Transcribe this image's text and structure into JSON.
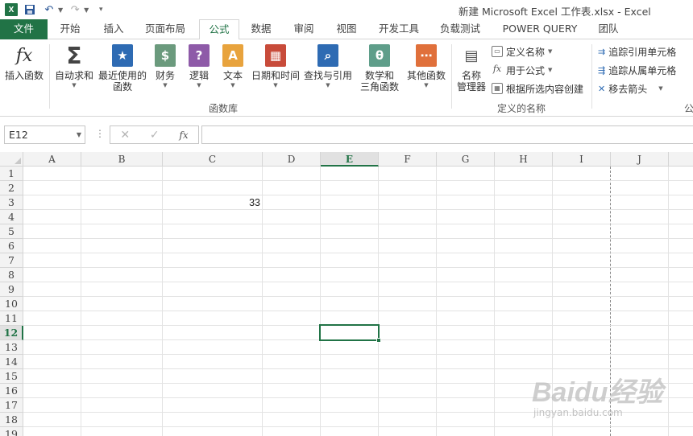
{
  "window": {
    "title": "新建 Microsoft Excel 工作表.xlsx - Excel"
  },
  "qat": {
    "logo": "X"
  },
  "tabs": [
    {
      "label": "文件"
    },
    {
      "label": "开始"
    },
    {
      "label": "插入"
    },
    {
      "label": "页面布局"
    },
    {
      "label": "公式"
    },
    {
      "label": "数据"
    },
    {
      "label": "审阅"
    },
    {
      "label": "视图"
    },
    {
      "label": "开发工具"
    },
    {
      "label": "负载测试"
    },
    {
      "label": "POWER QUERY"
    },
    {
      "label": "团队"
    }
  ],
  "ribbon": {
    "function_library": {
      "group_label": "函数库",
      "insert_function": {
        "icon": "fx",
        "label": "插入函数"
      },
      "autosum": {
        "label": "自动求和"
      },
      "recent": {
        "label1": "最近使用的",
        "label2": "函数"
      },
      "financial": {
        "label": "财务"
      },
      "logical": {
        "label": "逻辑"
      },
      "text": {
        "label": "文本"
      },
      "datetime": {
        "label": "日期和时间"
      },
      "lookup": {
        "label": "查找与引用"
      },
      "math": {
        "label1": "数学和",
        "label2": "三角函数"
      },
      "more": {
        "label": "其他函数"
      }
    },
    "defined_names": {
      "group_label": "定义的名称",
      "name_manager": {
        "label1": "名称",
        "label2": "管理器"
      },
      "define_name": "定义名称",
      "use_in_formula": "用于公式",
      "create_from_selection": "根据所选内容创建"
    },
    "auditing": {
      "trace_precedents": "追踪引用单元格",
      "trace_dependents": "追踪从属单元格",
      "remove_arrows": "移去箭头",
      "group_label_partial": "公"
    }
  },
  "formula_bar": {
    "name_box": "E12",
    "cancel": "✕",
    "enter": "✓",
    "fx": "fx",
    "formula": ""
  },
  "sheet": {
    "columns": [
      "A",
      "B",
      "C",
      "D",
      "E",
      "F",
      "G",
      "H",
      "I",
      "J"
    ],
    "selected_column": "E",
    "rows": [
      "1",
      "2",
      "3",
      "4",
      "5",
      "6",
      "7",
      "8",
      "9",
      "10",
      "11",
      "12",
      "13",
      "14",
      "15",
      "16",
      "17",
      "18",
      "19"
    ],
    "selected_row": "12",
    "cells": {
      "C3": "33"
    },
    "active_cell": "E12"
  },
  "watermark": {
    "main": "Baidu经验",
    "sub": "jingyan.baidu.com"
  },
  "colors": {
    "accent": "#217346"
  }
}
